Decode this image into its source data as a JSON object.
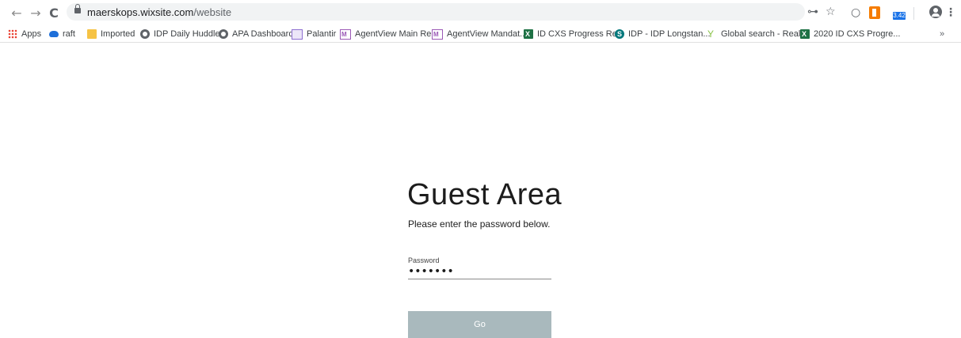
{
  "browser": {
    "url_host": "maerskops.wixsite.com",
    "url_path": "/website",
    "extension_badge": "3.42"
  },
  "bookmarks": [
    {
      "label": "Apps",
      "icon": "apps-grid-icon"
    },
    {
      "label": "raft",
      "icon": "cloud-icon"
    },
    {
      "label": "Imported",
      "icon": "folder-icon"
    },
    {
      "label": "IDP Daily Huddle",
      "icon": "globe-icon"
    },
    {
      "label": "APA Dashboard",
      "icon": "globe-icon"
    },
    {
      "label": "Palantir",
      "icon": "document-icon"
    },
    {
      "label": "AgentView Main Re...",
      "icon": "doc-m-icon"
    },
    {
      "label": "AgentView Mandat...",
      "icon": "doc-m-icon"
    },
    {
      "label": "ID CXS Progress Re...",
      "icon": "excel-icon"
    },
    {
      "label": "IDP - IDP Longstan...",
      "icon": "sharepoint-icon"
    },
    {
      "label": "Global search - Real...",
      "icon": "y-logo-icon"
    },
    {
      "label": "2020 ID CXS Progre...",
      "icon": "excel-icon"
    }
  ],
  "page": {
    "title": "Guest Area",
    "subtitle": "Please enter the password below.",
    "password_label": "Password",
    "password_masked": "•••••••",
    "go_label": "Go"
  },
  "colors": {
    "go_button": "#a9b9bd",
    "text": "#1c1c1c"
  }
}
